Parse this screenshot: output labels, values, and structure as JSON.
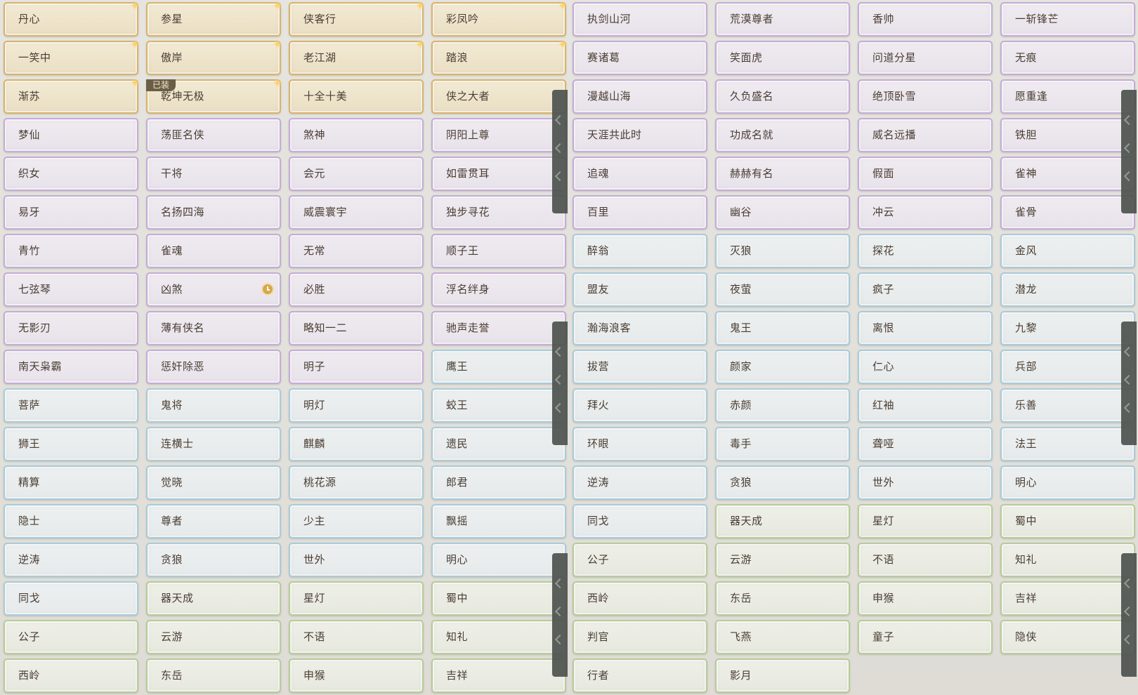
{
  "equipped_badge": "已装",
  "panels": [
    {
      "rows": [
        [
          {
            "t": "丹心",
            "c": "gold",
            "s": 1
          },
          {
            "t": "参星",
            "c": "gold",
            "s": 1
          },
          {
            "t": "侠客行",
            "c": "gold",
            "s": 1
          },
          {
            "t": "彩凤吟",
            "c": "gold",
            "s": 1
          }
        ],
        [
          {
            "t": "一笑中",
            "c": "gold",
            "s": 1
          },
          {
            "t": "傲岸",
            "c": "gold",
            "s": 1
          },
          {
            "t": "老江湖",
            "c": "gold",
            "s": 1
          },
          {
            "t": "踏浪",
            "c": "gold",
            "s": 1
          }
        ],
        [
          {
            "t": "渐苏",
            "c": "gold",
            "s": 1
          },
          {
            "t": "乾坤无极",
            "c": "gold",
            "s": 1,
            "e": 1
          },
          {
            "t": "十全十美",
            "c": "gold"
          },
          {
            "t": "侠之大者",
            "c": "gold"
          }
        ],
        [
          {
            "t": "梦仙",
            "c": "purple"
          },
          {
            "t": "荡匪名侠",
            "c": "purple"
          },
          {
            "t": "煞神",
            "c": "purple"
          },
          {
            "t": "阴阳上尊",
            "c": "purple"
          }
        ],
        [
          {
            "t": "织女",
            "c": "purple"
          },
          {
            "t": "干将",
            "c": "purple"
          },
          {
            "t": "会元",
            "c": "purple"
          },
          {
            "t": "如雷贯耳",
            "c": "purple"
          }
        ],
        [
          {
            "t": "易牙",
            "c": "purple"
          },
          {
            "t": "名扬四海",
            "c": "purple"
          },
          {
            "t": "威震寰宇",
            "c": "purple"
          },
          {
            "t": "独步寻花",
            "c": "purple"
          }
        ],
        [
          {
            "t": "青竹",
            "c": "purple"
          },
          {
            "t": "雀魂",
            "c": "purple"
          },
          {
            "t": "无常",
            "c": "purple"
          },
          {
            "t": "顺子王",
            "c": "purple"
          }
        ],
        [
          {
            "t": "七弦琴",
            "c": "purple"
          },
          {
            "t": "凶煞",
            "c": "purple",
            "k": 1
          },
          {
            "t": "必胜",
            "c": "purple"
          },
          {
            "t": "浮名绊身",
            "c": "purple"
          }
        ],
        [
          {
            "t": "无影刃",
            "c": "purple"
          },
          {
            "t": "薄有侠名",
            "c": "purple"
          },
          {
            "t": "略知一二",
            "c": "purple"
          },
          {
            "t": "驰声走誉",
            "c": "purple"
          }
        ],
        [
          {
            "t": "南天枭霸",
            "c": "purple"
          },
          {
            "t": "惩奸除恶",
            "c": "purple"
          },
          {
            "t": "明子",
            "c": "purple"
          },
          {
            "t": "鹰王",
            "c": "blue"
          }
        ],
        [
          {
            "t": "菩萨",
            "c": "blue"
          },
          {
            "t": "鬼将",
            "c": "blue"
          },
          {
            "t": "明灯",
            "c": "blue"
          },
          {
            "t": "蛟王",
            "c": "blue"
          }
        ],
        [
          {
            "t": "狮王",
            "c": "blue"
          },
          {
            "t": "连横士",
            "c": "blue"
          },
          {
            "t": "麒麟",
            "c": "blue"
          },
          {
            "t": "遗民",
            "c": "blue"
          }
        ],
        [
          {
            "t": "精算",
            "c": "blue"
          },
          {
            "t": "觉晓",
            "c": "blue"
          },
          {
            "t": "桃花源",
            "c": "blue"
          },
          {
            "t": "郎君",
            "c": "blue"
          }
        ],
        [
          {
            "t": "隐士",
            "c": "blue"
          },
          {
            "t": "尊者",
            "c": "blue"
          },
          {
            "t": "少主",
            "c": "blue"
          },
          {
            "t": "飘摇",
            "c": "blue"
          }
        ],
        [
          {
            "t": "逆涛",
            "c": "blue"
          },
          {
            "t": "贪狼",
            "c": "blue"
          },
          {
            "t": "世外",
            "c": "blue"
          },
          {
            "t": "明心",
            "c": "blue"
          }
        ],
        [
          {
            "t": "同戈",
            "c": "blue"
          },
          {
            "t": "器天成",
            "c": "green"
          },
          {
            "t": "星灯",
            "c": "green"
          },
          {
            "t": "蜀中",
            "c": "green"
          }
        ],
        [
          {
            "t": "公子",
            "c": "green"
          },
          {
            "t": "云游",
            "c": "green"
          },
          {
            "t": "不语",
            "c": "green"
          },
          {
            "t": "知礼",
            "c": "green"
          }
        ],
        [
          {
            "t": "西岭",
            "c": "green"
          },
          {
            "t": "东岳",
            "c": "green"
          },
          {
            "t": "申猴",
            "c": "green"
          },
          {
            "t": "吉祥",
            "c": "green"
          }
        ]
      ]
    },
    {
      "rows": [
        [
          {
            "t": "执剑山河",
            "c": "purple"
          },
          {
            "t": "荒漠尊者",
            "c": "purple"
          },
          {
            "t": "香帅",
            "c": "purple"
          },
          {
            "t": "一斩锋芒",
            "c": "purple"
          }
        ],
        [
          {
            "t": "赛诸葛",
            "c": "purple"
          },
          {
            "t": "笑面虎",
            "c": "purple"
          },
          {
            "t": "问道分星",
            "c": "purple"
          },
          {
            "t": "无痕",
            "c": "purple"
          }
        ],
        [
          {
            "t": "漫越山海",
            "c": "purple"
          },
          {
            "t": "久负盛名",
            "c": "purple"
          },
          {
            "t": "绝顶卧雪",
            "c": "purple"
          },
          {
            "t": "愿重逢",
            "c": "purple"
          }
        ],
        [
          {
            "t": "天涯共此时",
            "c": "purple"
          },
          {
            "t": "功成名就",
            "c": "purple"
          },
          {
            "t": "威名远播",
            "c": "purple"
          },
          {
            "t": "铁胆",
            "c": "purple"
          }
        ],
        [
          {
            "t": "追魂",
            "c": "purple"
          },
          {
            "t": "赫赫有名",
            "c": "purple"
          },
          {
            "t": "假面",
            "c": "purple"
          },
          {
            "t": "雀神",
            "c": "purple"
          }
        ],
        [
          {
            "t": "百里",
            "c": "purple"
          },
          {
            "t": "幽谷",
            "c": "purple"
          },
          {
            "t": "冲云",
            "c": "purple"
          },
          {
            "t": "雀骨",
            "c": "purple"
          }
        ],
        [
          {
            "t": "醉翁",
            "c": "blue"
          },
          {
            "t": "灭狼",
            "c": "blue"
          },
          {
            "t": "探花",
            "c": "blue"
          },
          {
            "t": "金风",
            "c": "blue"
          }
        ],
        [
          {
            "t": "盟友",
            "c": "blue"
          },
          {
            "t": "夜萤",
            "c": "blue"
          },
          {
            "t": "疯子",
            "c": "blue"
          },
          {
            "t": "潜龙",
            "c": "blue"
          }
        ],
        [
          {
            "t": "瀚海浪客",
            "c": "blue"
          },
          {
            "t": "鬼王",
            "c": "blue"
          },
          {
            "t": "离恨",
            "c": "blue"
          },
          {
            "t": "九黎",
            "c": "blue"
          }
        ],
        [
          {
            "t": "拔营",
            "c": "blue"
          },
          {
            "t": "颜家",
            "c": "blue"
          },
          {
            "t": "仁心",
            "c": "blue"
          },
          {
            "t": "兵部",
            "c": "blue"
          }
        ],
        [
          {
            "t": "拜火",
            "c": "blue"
          },
          {
            "t": "赤颜",
            "c": "blue"
          },
          {
            "t": "红袖",
            "c": "blue"
          },
          {
            "t": "乐善",
            "c": "blue"
          }
        ],
        [
          {
            "t": "环眼",
            "c": "blue"
          },
          {
            "t": "毒手",
            "c": "blue"
          },
          {
            "t": "聋哑",
            "c": "blue"
          },
          {
            "t": "法王",
            "c": "blue"
          }
        ],
        [
          {
            "t": "逆涛",
            "c": "blue"
          },
          {
            "t": "贪狼",
            "c": "blue"
          },
          {
            "t": "世外",
            "c": "blue"
          },
          {
            "t": "明心",
            "c": "blue"
          }
        ],
        [
          {
            "t": "同戈",
            "c": "blue"
          },
          {
            "t": "器天成",
            "c": "green"
          },
          {
            "t": "星灯",
            "c": "green"
          },
          {
            "t": "蜀中",
            "c": "green"
          }
        ],
        [
          {
            "t": "公子",
            "c": "green"
          },
          {
            "t": "云游",
            "c": "green"
          },
          {
            "t": "不语",
            "c": "green"
          },
          {
            "t": "知礼",
            "c": "green"
          }
        ],
        [
          {
            "t": "西岭",
            "c": "green"
          },
          {
            "t": "东岳",
            "c": "green"
          },
          {
            "t": "申猴",
            "c": "green"
          },
          {
            "t": "吉祥",
            "c": "green"
          }
        ],
        [
          {
            "t": "判官",
            "c": "green"
          },
          {
            "t": "飞燕",
            "c": "green"
          },
          {
            "t": "童子",
            "c": "green"
          },
          {
            "t": "隐侠",
            "c": "green"
          }
        ],
        [
          {
            "t": "行者",
            "c": "green"
          },
          {
            "t": "影月",
            "c": "green"
          }
        ]
      ]
    }
  ]
}
